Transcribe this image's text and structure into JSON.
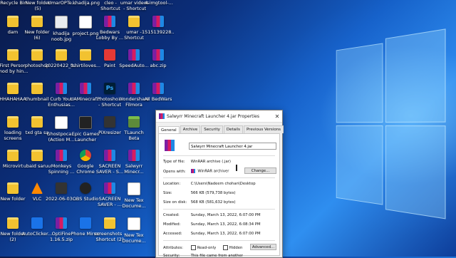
{
  "desktop": {
    "top_row_labels": [
      "Recycle Bin",
      "New folder\n(5)",
      "UmarOPTe...",
      "khadija.png",
      "cleo -\nShortcut",
      "umar videos\n- Shortcut",
      "4-imgtool-..."
    ],
    "icons": [
      {
        "label": "dam",
        "type": "folder"
      },
      {
        "label": "New folder\n(6)",
        "type": "folder"
      },
      {
        "label": "khadija\nnoob.jpg",
        "type": "img"
      },
      {
        "label": "project.png",
        "type": "doc"
      },
      {
        "label": "Bedwars\nLobby By ...",
        "type": "rar"
      },
      {
        "label": "umar -\nShortcut",
        "type": "folder"
      },
      {
        "label": "1515139228...",
        "type": "rar"
      },
      {
        "label": "First Person\nmod by hin...",
        "type": "folder"
      },
      {
        "label": "photoshop",
        "type": "folder"
      },
      {
        "label": "20220422_1...",
        "type": "folder"
      },
      {
        "label": "tshirtiloves...",
        "type": "folder"
      },
      {
        "label": "Paint",
        "type": "red"
      },
      {
        "label": "SpeedAuto...",
        "type": "rar"
      },
      {
        "label": "abc.zip",
        "type": "rar"
      },
      {
        "label": "HHAHAHAA",
        "type": "folder"
      },
      {
        "label": "thumbnail",
        "type": "folder"
      },
      {
        "label": "Curb Your\nEnthusias...",
        "type": "rar"
      },
      {
        "label": "UAMinecraf...",
        "type": "rar"
      },
      {
        "label": "Photosho...\n- Shortcut",
        "type": "ps"
      },
      {
        "label": "Wondershare\nFilmora",
        "type": "rar"
      },
      {
        "label": "All BedWars",
        "type": "rar"
      },
      {
        "label": "loading\nscreens",
        "type": "folder"
      },
      {
        "label": "txd gta sa",
        "type": "folder"
      },
      {
        "label": "Ghostpoca...\n(Action M...",
        "type": "doc"
      },
      {
        "label": "Epic Games\nLauncher",
        "type": "game"
      },
      {
        "label": "PiXresizer",
        "type": "app"
      },
      {
        "label": "TLaunch\nBeta",
        "type": "mc"
      },
      {
        "label": "",
        "type": "none"
      },
      {
        "label": "Microvirt",
        "type": "folder"
      },
      {
        "label": "ubaid saruu",
        "type": "folder"
      },
      {
        "label": "Monkeys\nSpinning ...",
        "type": "rar"
      },
      {
        "label": "Google\nChrome",
        "type": "chrome"
      },
      {
        "label": "SACREEN\nSAVER - S...",
        "type": "rar"
      },
      {
        "label": "Salwyrr\nMinecr...",
        "type": "rar"
      },
      {
        "label": "",
        "type": "none"
      },
      {
        "label": "New folder",
        "type": "folder"
      },
      {
        "label": "VLC",
        "type": "vlc"
      },
      {
        "label": "2022-06-03...",
        "type": "app"
      },
      {
        "label": "OBS Studio",
        "type": "round"
      },
      {
        "label": "SACREEN\nSAVER - ...",
        "type": "rar"
      },
      {
        "label": "New Tex\nDocume...",
        "type": "doc"
      },
      {
        "label": "",
        "type": "none"
      },
      {
        "label": "New folder\n(2)",
        "type": "folder"
      },
      {
        "label": "AutoClicker...",
        "type": "blue"
      },
      {
        "label": "OptiFine\n1.16.5.zip",
        "type": "rar"
      },
      {
        "label": "Phone Mirror",
        "type": "blue"
      },
      {
        "label": "screenshots -\nShortcut (2)",
        "type": "folder"
      },
      {
        "label": "New Tex\nDocume...",
        "type": "doc"
      },
      {
        "label": "",
        "type": "none"
      }
    ]
  },
  "dialog": {
    "title": "Salwyrr Minecraft Launcher 4.jar Properties",
    "close_glyph": "✕",
    "tabs": [
      "General",
      "Archive",
      "Security",
      "Details",
      "Previous Versions"
    ],
    "active_tab": "General",
    "file_name": "Salwyrr Minecraft Launcher 4.jar",
    "type_of_file_label": "Type of file:",
    "type_of_file_value": "WinRAR archive (.jar)",
    "opens_with_label": "Opens with:",
    "opens_with_value": "WinRAR archiver",
    "change_button": "Change...",
    "location_label": "Location:",
    "location_value": "C:\\Users\\Nadeem chohan\\Desktop",
    "size_label": "Size:",
    "size_value": "566 KB (579,738 bytes)",
    "size_on_disk_label": "Size on disk:",
    "size_on_disk_value": "568 KB (581,632 bytes)",
    "created_label": "Created:",
    "created_value": "Sunday, March 13, 2022, 6:07:00 PM",
    "modified_label": "Modified:",
    "modified_value": "Sunday, March 13, 2022, 6:08:34 PM",
    "accessed_label": "Accessed:",
    "accessed_value": "Sunday, March 13, 2022, 6:07:00 PM",
    "attributes_label": "Attributes:",
    "readonly_label": "Read-only",
    "hidden_label": "Hidden",
    "advanced_button": "Advanced...",
    "security_label": "Security:",
    "security_value": "This file came from another"
  }
}
